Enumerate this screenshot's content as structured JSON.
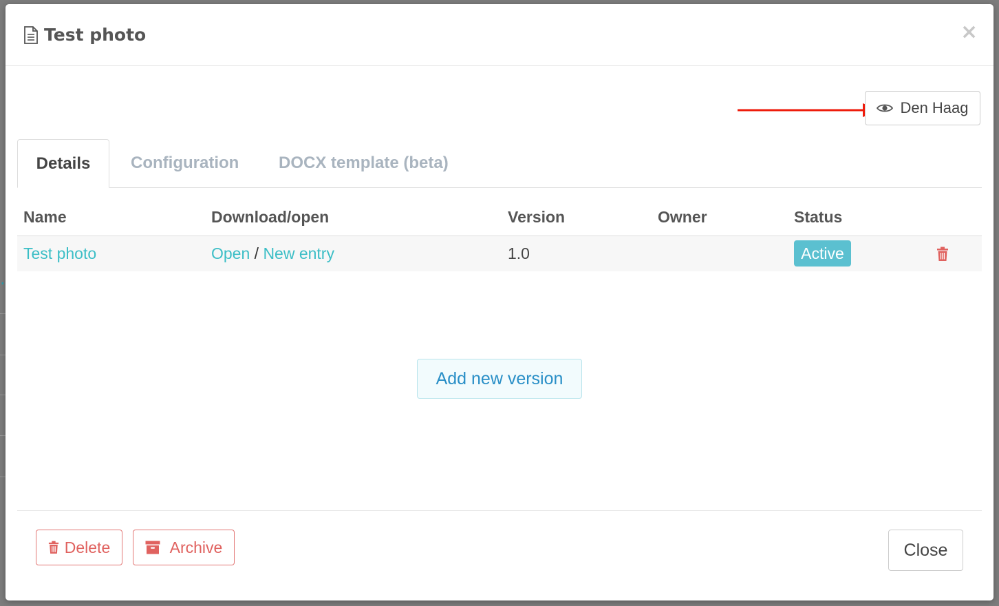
{
  "modal": {
    "title": "Test photo",
    "close_symbol": "×",
    "view_button": {
      "label": "Den Haag",
      "icon": "eye-icon"
    }
  },
  "tabs": [
    {
      "label": "Details",
      "active": true
    },
    {
      "label": "Configuration",
      "active": false
    },
    {
      "label": "DOCX template (beta)",
      "active": false
    }
  ],
  "table": {
    "headers": [
      "Name",
      "Download/open",
      "Version",
      "Owner",
      "Status"
    ],
    "rows": [
      {
        "name": "Test photo",
        "open_label": "Open",
        "separator": "/",
        "new_entry_label": "New entry",
        "version": "1.0",
        "owner": "",
        "status": "Active"
      }
    ]
  },
  "add_version_label": "Add new version",
  "footer": {
    "delete_label": "Delete",
    "archive_label": "Archive",
    "close_label": "Close"
  },
  "colors": {
    "link": "#3bbec6",
    "status_badge": "#5bc0d0",
    "danger": "#e0625f",
    "primary_text": "#2a8fc7",
    "annotation_arrow": "#ee1c0c"
  }
}
